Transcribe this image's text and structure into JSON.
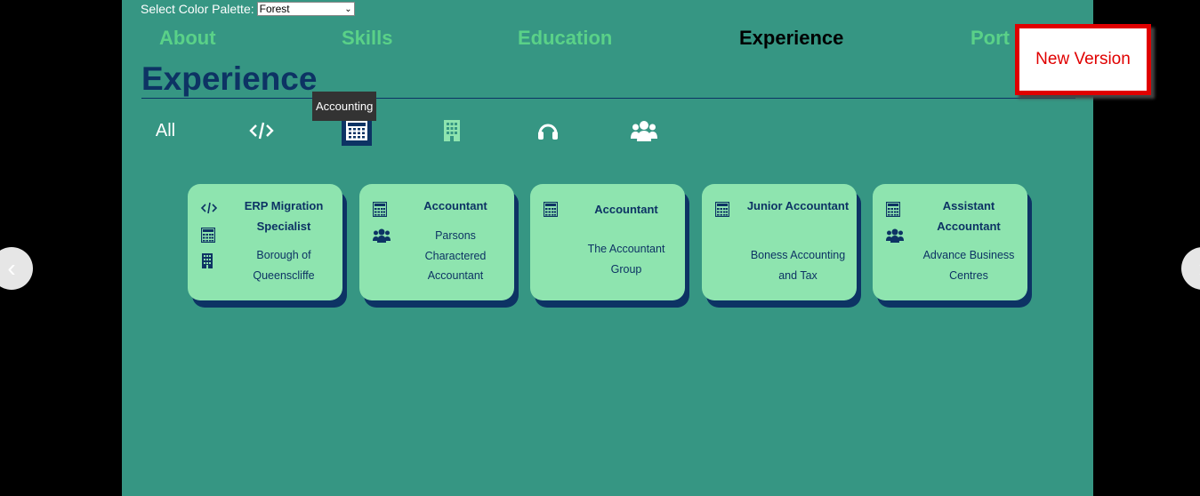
{
  "palette": {
    "label": "Select Color Palette:",
    "selected": "Forest"
  },
  "nav": [
    {
      "label": "About"
    },
    {
      "label": "Skills"
    },
    {
      "label": "Education"
    },
    {
      "label": "Experience"
    },
    {
      "label": "Port"
    }
  ],
  "section_title": "Experience",
  "filters": {
    "all_label": "All",
    "tooltip": "Accounting",
    "icons": [
      "code-icon",
      "calculator-icon",
      "building-icon",
      "headset-icon",
      "users-icon"
    ]
  },
  "cards": [
    {
      "role": "ERP Migration Specialist",
      "company": "Borough of Queenscliffe",
      "icons": [
        "code-icon",
        "calculator-icon",
        "building-icon"
      ]
    },
    {
      "role": "Accountant",
      "company": "Parsons Charactered Accountant",
      "icons": [
        "calculator-icon",
        "users-icon"
      ]
    },
    {
      "role": "Accountant",
      "company": "The Accountant Group",
      "icons": [
        "calculator-icon"
      ]
    },
    {
      "role": "Junior Accountant",
      "company": "Boness Accounting and Tax",
      "icons": [
        "calculator-icon"
      ]
    },
    {
      "role": "Assistant Accountant",
      "company": "Advance Business Centres",
      "icons": [
        "calculator-icon",
        "users-icon"
      ]
    }
  ],
  "new_version": "New Version",
  "colors": {
    "page_bg": "#369683",
    "card_bg": "#8ee4af",
    "navy": "#0d3364",
    "nav_green": "#5ad188",
    "alert_red": "#e00000"
  }
}
